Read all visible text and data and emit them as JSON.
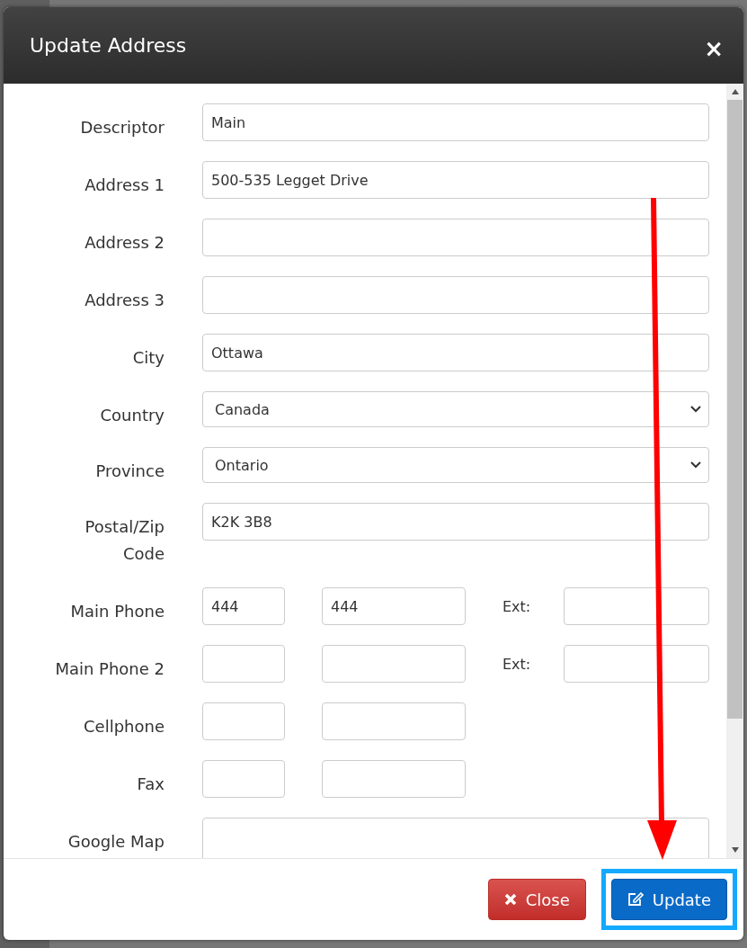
{
  "dialog": {
    "title": "Update Address",
    "close_icon": "×"
  },
  "fields": [
    {
      "kind": "text",
      "label": "Descriptor",
      "value": "Main"
    },
    {
      "kind": "text",
      "label": "Address 1",
      "value": "500-535 Legget Drive"
    },
    {
      "kind": "text",
      "label": "Address 2"
    },
    {
      "kind": "text",
      "label": "Address 3"
    },
    {
      "kind": "text",
      "label": "City",
      "value": "Ottawa"
    },
    {
      "kind": "select",
      "label": "Country",
      "value": "Canada"
    },
    {
      "kind": "select",
      "label": "Province",
      "value": "Ontario"
    },
    {
      "kind": "text",
      "label": "Postal/Zip Code",
      "value": "K2K 3B8"
    },
    {
      "kind": "phone",
      "label": "Main Phone",
      "area": "444",
      "number": "444",
      "ext_label": "Ext:"
    },
    {
      "kind": "phone",
      "label": "Main Phone 2",
      "ext_label": "Ext:"
    },
    {
      "kind": "phone",
      "label": "Cellphone"
    },
    {
      "kind": "phone",
      "label": "Fax"
    },
    {
      "kind": "textarea",
      "label": "Google Map"
    }
  ],
  "footer": {
    "buttons": [
      {
        "kind": "close",
        "label": "Close",
        "highlighted": false
      },
      {
        "kind": "update",
        "label": "Update",
        "highlighted": true
      }
    ]
  },
  "annotation": {
    "arrow": true
  }
}
